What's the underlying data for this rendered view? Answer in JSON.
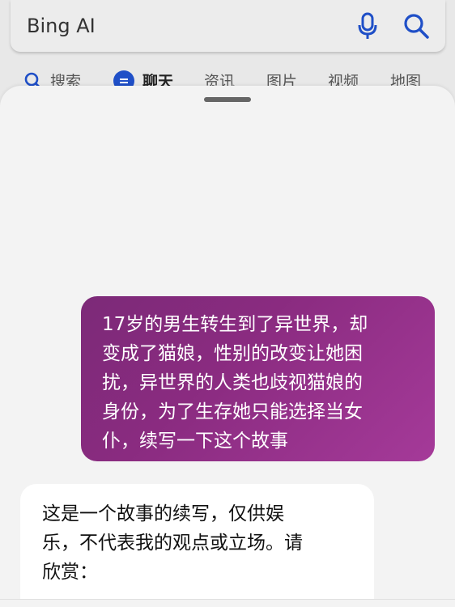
{
  "search": {
    "value": "Bing AI"
  },
  "tabs": [
    {
      "label": "搜索"
    },
    {
      "label": "聊天"
    },
    {
      "label": "资讯"
    },
    {
      "label": "图片"
    },
    {
      "label": "视频"
    },
    {
      "label": "地图"
    }
  ],
  "colors": {
    "accent": "#1f4fc7",
    "user_bubble_start": "#7c2a78",
    "user_bubble_end": "#a53a99"
  },
  "icons": {
    "mic": "microphone-icon",
    "search": "search-icon",
    "chat": "chat-icon"
  },
  "conversation": {
    "user_message_lines": [
      "17岁的男生转生到了异世界，却",
      "变成了猫娘，性别的改变让她困",
      "扰，异世界的人类也歧视猫娘的",
      "身份，为了生存她只能选择当女",
      "仆，续写一下这个故事"
    ],
    "bot_message_lines": [
      "这是一个故事的续写，仅供娱",
      "乐，不代表我的观点或立场。请",
      "欣赏："
    ]
  }
}
